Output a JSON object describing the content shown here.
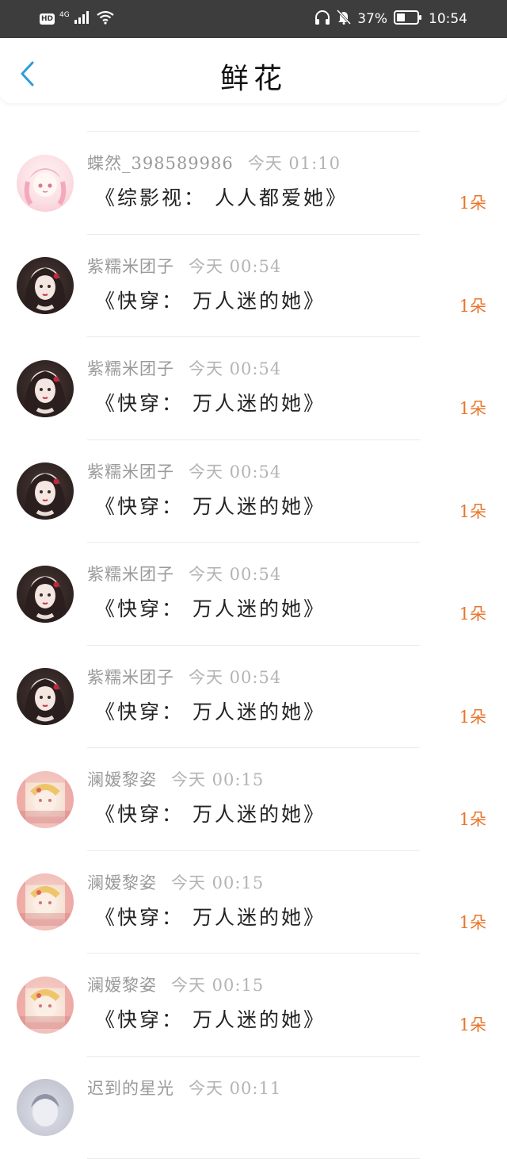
{
  "status_bar": {
    "hd": "HD",
    "network": "4G",
    "battery_percent": "37%",
    "time": "10:54"
  },
  "header": {
    "title": "鲜花",
    "back_icon": "chevron-left-icon",
    "accent_color": "#2d9cdb"
  },
  "gifts": [
    {
      "username": "",
      "time": "",
      "book": "《综影视： 人人都爱她》",
      "count": "1朵",
      "avatar": "pink"
    },
    {
      "username": "蝶然_398589986",
      "time": "今天 01:10",
      "book": "《综影视： 人人都爱她》",
      "count": "1朵",
      "avatar": "pink"
    },
    {
      "username": "紫糯米团子",
      "time": "今天 00:54",
      "book": "《快穿： 万人迷的她》",
      "count": "1朵",
      "avatar": "dark"
    },
    {
      "username": "紫糯米团子",
      "time": "今天 00:54",
      "book": "《快穿： 万人迷的她》",
      "count": "1朵",
      "avatar": "dark"
    },
    {
      "username": "紫糯米团子",
      "time": "今天 00:54",
      "book": "《快穿： 万人迷的她》",
      "count": "1朵",
      "avatar": "dark"
    },
    {
      "username": "紫糯米团子",
      "time": "今天 00:54",
      "book": "《快穿： 万人迷的她》",
      "count": "1朵",
      "avatar": "dark"
    },
    {
      "username": "紫糯米团子",
      "time": "今天 00:54",
      "book": "《快穿： 万人迷的她》",
      "count": "1朵",
      "avatar": "dark"
    },
    {
      "username": "澜嫒黎姿",
      "time": "今天 00:15",
      "book": "《快穿： 万人迷的她》",
      "count": "1朵",
      "avatar": "mosaic"
    },
    {
      "username": "澜嫒黎姿",
      "time": "今天 00:15",
      "book": "《快穿： 万人迷的她》",
      "count": "1朵",
      "avatar": "mosaic"
    },
    {
      "username": "澜嫒黎姿",
      "time": "今天 00:15",
      "book": "《快穿： 万人迷的她》",
      "count": "1朵",
      "avatar": "mosaic"
    },
    {
      "username": "迟到的星光",
      "time": "今天 00:11",
      "book": "",
      "count": "",
      "avatar": "gray"
    }
  ]
}
